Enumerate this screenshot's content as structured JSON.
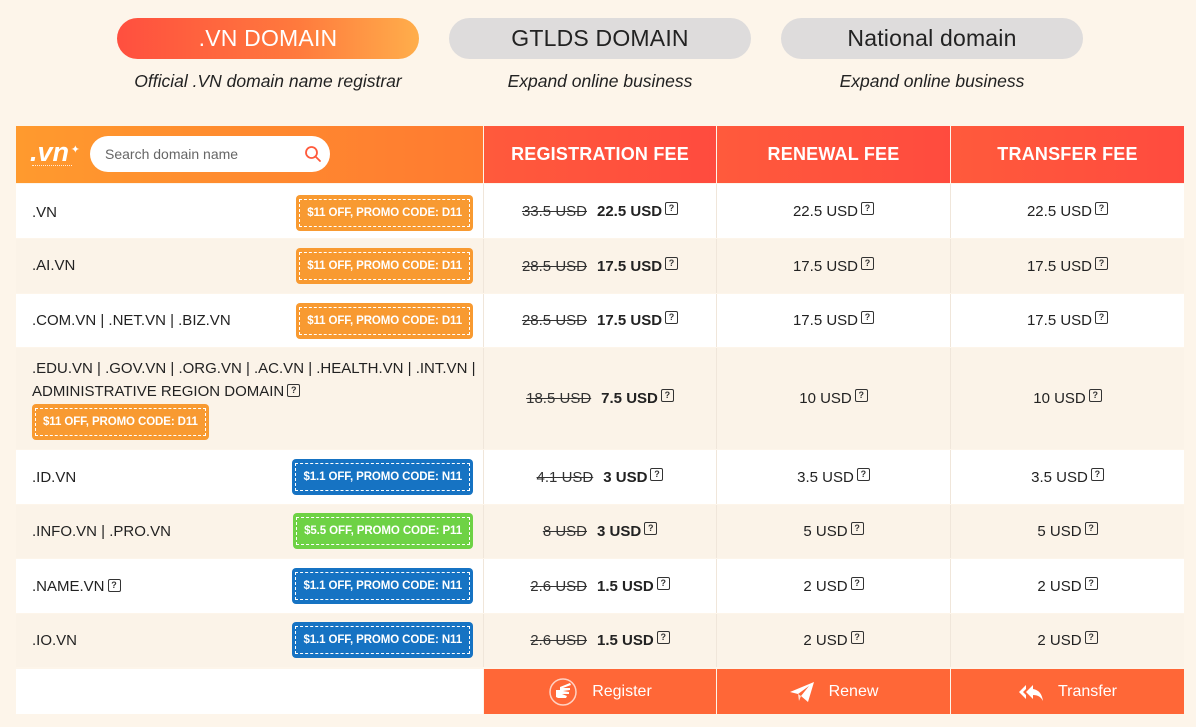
{
  "tabs": [
    {
      "label": ".VN DOMAIN",
      "subtitle": "Official .VN domain name registrar",
      "active": true
    },
    {
      "label": "GTLDS DOMAIN",
      "subtitle": "Expand online business",
      "active": false
    },
    {
      "label": "National domain",
      "subtitle": "Expand online business",
      "active": false
    }
  ],
  "header": {
    "logo": ".vn",
    "search_placeholder": "Search domain name",
    "col_registration": "REGISTRATION FEE",
    "col_renewal": "RENEWAL FEE",
    "col_transfer": "TRANSFER FEE"
  },
  "rows": [
    {
      "name": ".VN",
      "promo": "$11 OFF, PROMO CODE: D11",
      "promo_color": "orange",
      "old": "33.5 USD",
      "reg": "22.5 USD",
      "renew": "22.5 USD",
      "transfer": "22.5 USD"
    },
    {
      "name": ".AI.VN",
      "promo": "$11 OFF, PROMO CODE: D11",
      "promo_color": "orange",
      "old": "28.5 USD",
      "reg": "17.5 USD",
      "renew": "17.5 USD",
      "transfer": "17.5 USD"
    },
    {
      "name": ".COM.VN | .NET.VN | .BIZ.VN",
      "promo": "$11 OFF, PROMO CODE: D11",
      "promo_color": "orange",
      "old": "28.5 USD",
      "reg": "17.5 USD",
      "renew": "17.5 USD",
      "transfer": "17.5 USD"
    },
    {
      "name_line1": ".EDU.VN | .GOV.VN | .ORG.VN | .AC.VN | .HEALTH.VN | .INT.VN |",
      "name_line2": "ADMINISTRATIVE REGION DOMAIN",
      "promo": "$11 OFF, PROMO CODE: D11",
      "promo_color": "orange",
      "old": "18.5 USD",
      "reg": "7.5 USD",
      "renew": "10 USD",
      "transfer": "10 USD"
    },
    {
      "name": ".ID.VN",
      "promo": "$1.1 OFF, PROMO CODE: N11",
      "promo_color": "blue",
      "old": "4.1 USD",
      "reg": "3 USD",
      "renew": "3.5 USD",
      "transfer": "3.5 USD"
    },
    {
      "name": ".INFO.VN | .PRO.VN",
      "promo": "$5.5 OFF, PROMO CODE: P11",
      "promo_color": "green",
      "old": "8 USD",
      "reg": "3 USD",
      "renew": "5 USD",
      "transfer": "5 USD"
    },
    {
      "name": ".NAME.VN",
      "promo": "$1.1 OFF, PROMO CODE: N11",
      "promo_color": "blue",
      "old": "2.6 USD",
      "reg": "1.5 USD",
      "renew": "2 USD",
      "transfer": "2 USD"
    },
    {
      "name": ".IO.VN",
      "promo": "$1.1 OFF, PROMO CODE: N11",
      "promo_color": "blue",
      "old": "2.6 USD",
      "reg": "1.5 USD",
      "renew": "2 USD",
      "transfer": "2 USD"
    }
  ],
  "footer": {
    "register": "Register",
    "renew": "Renew",
    "transfer": "Transfer"
  },
  "help_glyph": "?",
  "colors": {
    "accent": "#ff5a3c",
    "orange_promo": "#f89a31",
    "blue_promo": "#1673c3",
    "green_promo": "#6ed245"
  }
}
